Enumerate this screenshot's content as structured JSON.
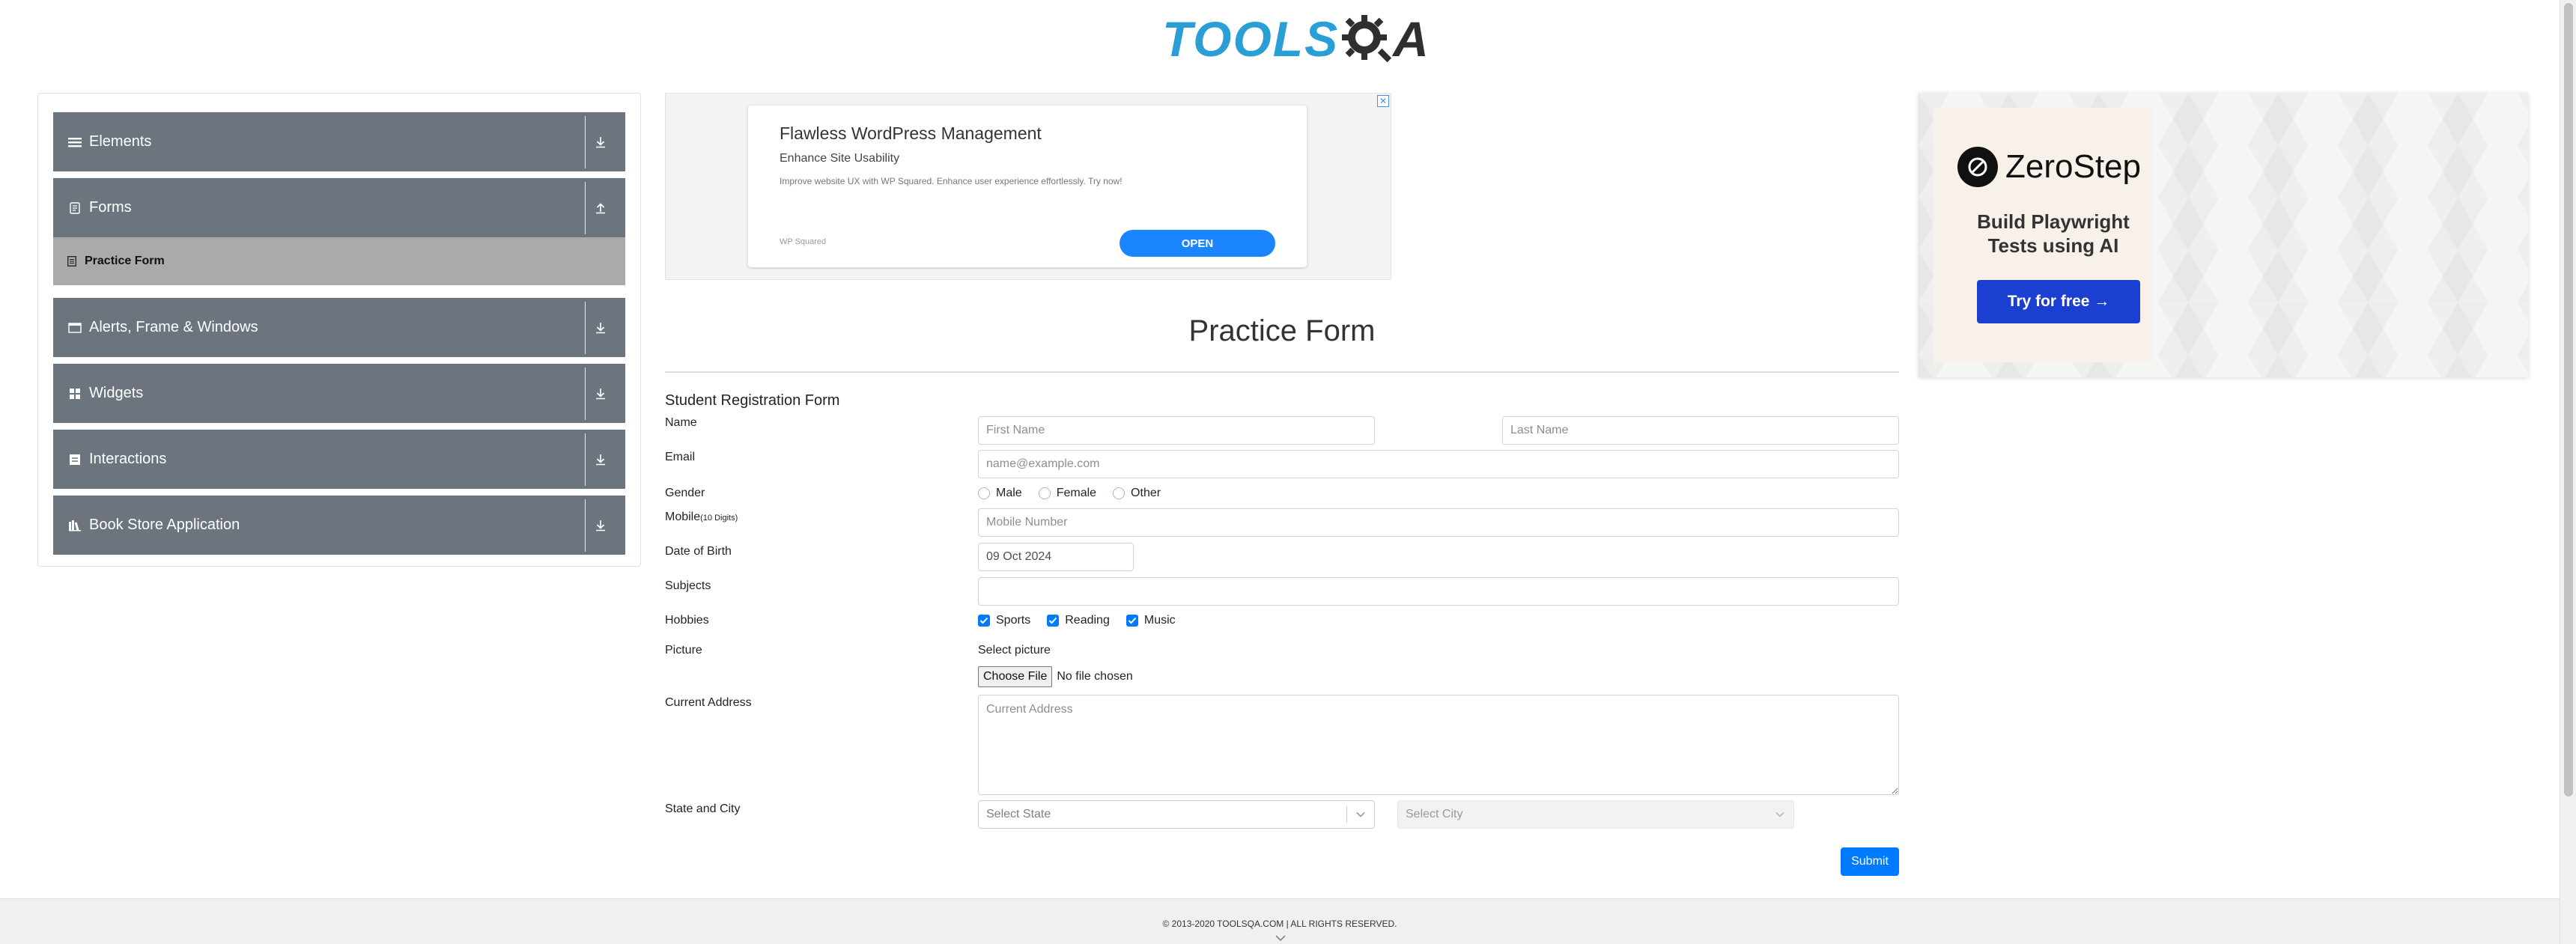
{
  "header": {
    "logo_tools": "TOOLS",
    "logo_qa_a": "A",
    "logo_alt": "ToolsQA"
  },
  "sidebar": {
    "groups": [
      {
        "label": "Elements",
        "icon": "hamburger-icon",
        "toggle_icon": "download-arrow-icon"
      },
      {
        "label": "Forms",
        "icon": "document-icon",
        "toggle_icon": "upload-arrow-icon"
      },
      {
        "label": "Alerts, Frame & Windows",
        "icon": "window-icon",
        "toggle_icon": "download-arrow-icon"
      },
      {
        "label": "Widgets",
        "icon": "grid-icon",
        "toggle_icon": "download-arrow-icon"
      },
      {
        "label": "Interactions",
        "icon": "box-icon",
        "toggle_icon": "download-arrow-icon"
      },
      {
        "label": "Book Store Application",
        "icon": "books-icon",
        "toggle_icon": "download-arrow-icon"
      }
    ],
    "forms_items": [
      {
        "label": "Practice Form",
        "icon": "list-icon",
        "active": true
      }
    ]
  },
  "center_ad": {
    "title": "Flawless WordPress Management",
    "subtitle": "Enhance Site Usability",
    "description": "Improve website UX with WP Squared. Enhance user experience effortlessly. Try now!",
    "brand": "WP Squared",
    "cta": "OPEN",
    "close": "✕"
  },
  "right_ad": {
    "brand": "ZeroStep",
    "tagline": "Build Playwright Tests using AI",
    "cta": "Try for free →"
  },
  "form": {
    "page_title": "Practice Form",
    "heading": "Student Registration Form",
    "labels": {
      "name": "Name",
      "email": "Email",
      "gender": "Gender",
      "mobile": "Mobile",
      "mobile_hint": "(10 Digits)",
      "dob": "Date of Birth",
      "subjects": "Subjects",
      "hobbies": "Hobbies",
      "picture": "Picture",
      "address": "Current Address",
      "state_city": "State and City"
    },
    "first_name": {
      "value": "",
      "placeholder": "First Name"
    },
    "last_name": {
      "value": "",
      "placeholder": "Last Name"
    },
    "email": {
      "value": "",
      "placeholder": "name@example.com"
    },
    "gender_options": [
      "Male",
      "Female",
      "Other"
    ],
    "mobile": {
      "value": "",
      "placeholder": "Mobile Number"
    },
    "dob": {
      "value": "09 Oct 2024"
    },
    "subjects": {
      "value": ""
    },
    "hobbies": [
      {
        "label": "Sports",
        "checked": true
      },
      {
        "label": "Reading",
        "checked": true
      },
      {
        "label": "Music",
        "checked": true
      }
    ],
    "picture_caption": "Select picture",
    "file_button": "Choose File",
    "file_status": "No file chosen",
    "address": {
      "value": "",
      "placeholder": "Current Address"
    },
    "state": {
      "placeholder": "Select State"
    },
    "city": {
      "placeholder": "Select City"
    },
    "submit": "Submit"
  },
  "footer": {
    "text": "© 2013-2020 TOOLSQA.COM | ALL RIGHTS RESERVED."
  },
  "colors": {
    "sidebar_group": "#6c757d",
    "active_item": "#aaaaaa",
    "primary": "#007bff",
    "logo_blue": "#2a9fd6"
  }
}
